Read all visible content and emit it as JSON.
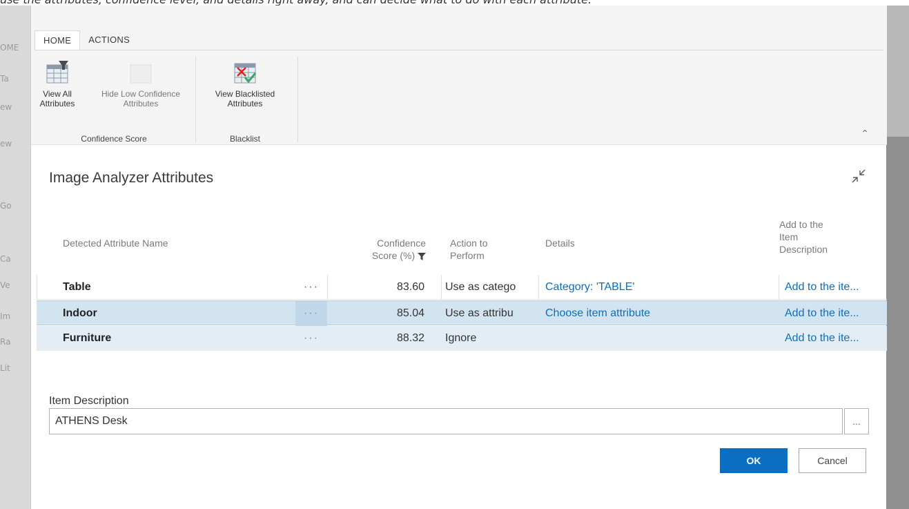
{
  "caption": "use the attributes, confidence level, and details right away, and can decide what to do with each attribute.",
  "background_fragments": [
    "OME",
    "Ta",
    "ew",
    "ew",
    "Go",
    "Ca",
    "Ve",
    "Im",
    "Ra",
    "Lit"
  ],
  "ribbon": {
    "tabs": [
      "HOME",
      "ACTIONS"
    ],
    "active_tab": "HOME",
    "groups": [
      {
        "label": "Confidence Score",
        "buttons": [
          {
            "label_line1": "View All",
            "label_line2": "Attributes",
            "icon": "grid-filter-icon",
            "enabled": true
          },
          {
            "label_line1": "Hide Low Confidence",
            "label_line2": "Attributes",
            "icon": "grid-icon",
            "enabled": false
          }
        ]
      },
      {
        "label": "Blacklist",
        "buttons": [
          {
            "label_line1": "View Blacklisted",
            "label_line2": "Attributes",
            "icon": "grid-blacklist-icon",
            "enabled": true
          }
        ]
      }
    ]
  },
  "dialog": {
    "title": "Image Analyzer Attributes"
  },
  "table": {
    "headers": {
      "name": "Detected Attribute Name",
      "confidence_line1": "Confidence",
      "confidence_line2": "Score (%)",
      "action_line1": "Action to",
      "action_line2": "Perform",
      "details": "Details",
      "add_line1": "Add to the",
      "add_line2": "Item",
      "add_line3": "Description"
    },
    "rows": [
      {
        "name": "Table",
        "score": "83.60",
        "action": "Use as catego",
        "details": "Category: 'TABLE'",
        "add": "Add to the ite..."
      },
      {
        "name": "Indoor",
        "score": "85.04",
        "action": "Use as attribu",
        "details": "Choose item attribute",
        "add": "Add to the ite..."
      },
      {
        "name": "Furniture",
        "score": "88.32",
        "action": "Ignore",
        "details": "",
        "add": "Add to the ite..."
      }
    ],
    "ellipsis": "···"
  },
  "item_description": {
    "label": "Item Description",
    "value": "ATHENS Desk",
    "button": "..."
  },
  "footer": {
    "ok": "OK",
    "cancel": "Cancel"
  },
  "colors": {
    "accent": "#0a6fc2",
    "selected_row": "#d3e4f1",
    "ribbon_bg": "#f4f4f4"
  }
}
